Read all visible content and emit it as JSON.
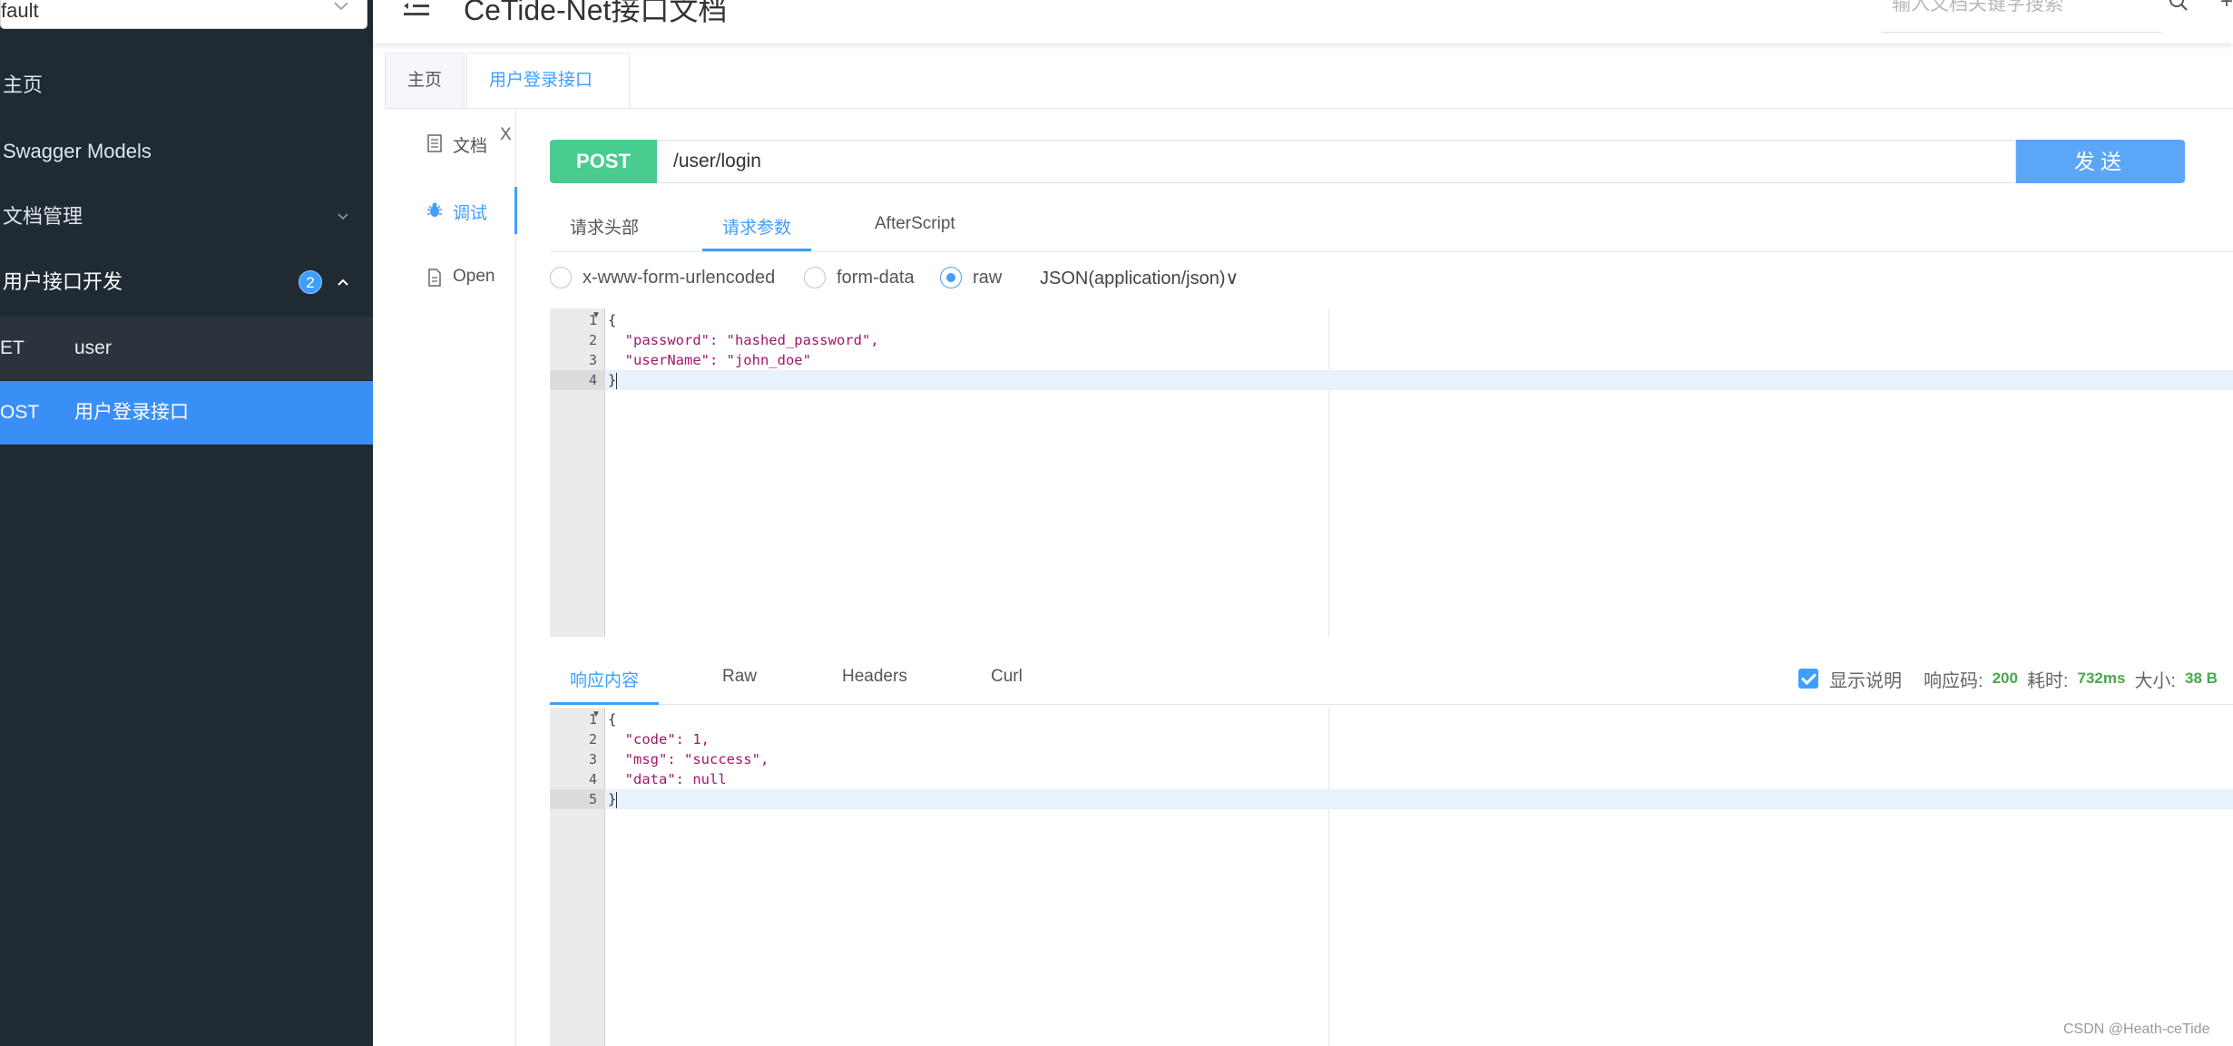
{
  "sidebar": {
    "group_select": "fault",
    "menu": [
      {
        "label": "主页"
      },
      {
        "label": "Swagger Models"
      },
      {
        "label": "文档管理"
      },
      {
        "label": "用户接口开发",
        "badge": "2"
      }
    ],
    "apis": [
      {
        "method": "ET",
        "name": "user"
      },
      {
        "method": "OST",
        "name": "用户登录接口"
      }
    ]
  },
  "header": {
    "title": "CeTide-Net接口文档",
    "search_placeholder": "输入文档关键字搜索",
    "more_glyph": "+"
  },
  "tabs": [
    {
      "label": "主页"
    },
    {
      "label": "用户登录接口",
      "close": "X"
    }
  ],
  "submenu": [
    {
      "label": "文档",
      "icon": "document-icon"
    },
    {
      "label": "调试",
      "icon": "bug-icon"
    },
    {
      "label": "Open",
      "icon": "file-icon"
    }
  ],
  "request": {
    "method": "POST",
    "url": "/user/login",
    "send_label": "发送",
    "tabs": [
      "请求头部",
      "请求参数",
      "AfterScript"
    ],
    "active_tab": "请求参数",
    "body_types": [
      "x-www-form-urlencoded",
      "form-data",
      "raw"
    ],
    "selected_body_type": "raw",
    "content_type": "JSON(application/json)",
    "content_type_arrow": "∨",
    "body_lines": [
      "{",
      "  \"password\": \"hashed_password\",",
      "  \"userName\": \"john_doe\"",
      "}"
    ],
    "line_numbers": [
      "1",
      "2",
      "3",
      "4"
    ]
  },
  "response": {
    "tabs": [
      "响应内容",
      "Raw",
      "Headers",
      "Curl"
    ],
    "active_tab": "响应内容",
    "show_desc_label": "显示说明",
    "status_label": "响应码:",
    "status_value": "200",
    "time_label": "耗时:",
    "time_value": "732ms",
    "size_label": "大小:",
    "size_value": "38 B",
    "body_lines": [
      "{",
      "  \"code\": 1,",
      "  \"msg\": \"success\",",
      "  \"data\": null",
      "}"
    ],
    "line_numbers": [
      "1",
      "2",
      "3",
      "4",
      "5"
    ]
  },
  "watermark": "CSDN @Heath-ceTide",
  "colors": {
    "sidebar_bg": "#1f2a33",
    "accent": "#409eff",
    "post_green": "#49cc90",
    "send_blue": "#5ba6f7"
  }
}
